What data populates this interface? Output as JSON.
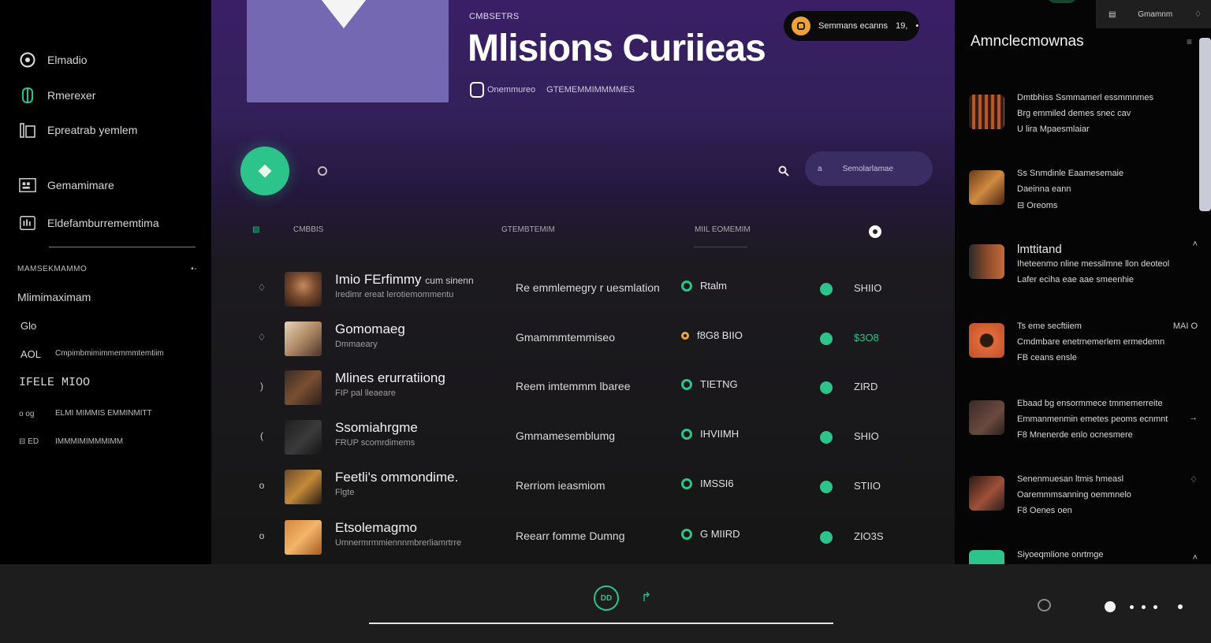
{
  "sidebar": {
    "nav": [
      {
        "label": "Elmadio",
        "icon": "home-icon"
      },
      {
        "label": "Rmerexer",
        "icon": "explore-icon"
      },
      {
        "label": "Epreatrab yemlem",
        "icon": "library-icon"
      },
      {
        "label": "Gemamimare",
        "icon": "calendar-icon"
      },
      {
        "label": "Eldefamburrememtima",
        "icon": "playlist-icon"
      }
    ],
    "section_head": "MAMSEKMAMMO",
    "section_toggle": "•-",
    "items": [
      {
        "label": "Mlimimaximam"
      },
      {
        "label": "Glo"
      },
      {
        "prefix": "AOL",
        "label": "Cmpimbmimimmemmmtemtiim"
      },
      {
        "label": "IFELE MIOO"
      },
      {
        "prefix": "o og",
        "label": "ELMI MIMMIS EMMINMITT"
      },
      {
        "prefix": "⊟ ED",
        "label": "IMMMIMIMMMIMM"
      }
    ]
  },
  "header": {
    "eyebrow": "CMBSETRS",
    "title": "Mlisions Curiieas",
    "meta_a": "Onemmureo",
    "meta_b": "GTEMEMMIMMMMES",
    "now_playing": "Semmans ecanns",
    "now_count": "19,",
    "now_icon": "•"
  },
  "controls": {
    "search_placeholder": "Semolarlamae",
    "search_prefix": "a"
  },
  "table": {
    "headers": {
      "title": "CMBBIS",
      "album": "GTEMBTEMIM",
      "status": "MIIL EOMEMIM"
    },
    "rows": [
      {
        "num": "♢",
        "title": "Imio FErfimmy",
        "title_extra": "cum sinenn",
        "subtitle": "Iredimr ereat lerotiemommentu",
        "album": "Re emmlemegry r uesmlation",
        "status": "Rtalm",
        "ring": "green",
        "duration": "SHIIO",
        "dur_color": "normal"
      },
      {
        "num": "♢",
        "title": "Gomomaeg",
        "title_extra": "",
        "subtitle": "Dmmaeary",
        "album": "Gmammmtemmiseo",
        "status": "f8G8 BIIO",
        "ring": "orange",
        "duration": "$3O8",
        "dur_color": "green"
      },
      {
        "num": ")",
        "title": "Mlines erurratiiong",
        "title_extra": "",
        "subtitle": "FIP pal lleaeare",
        "album": "Reem imtemmm lbaree",
        "status": "TIETNG",
        "ring": "green",
        "duration": "ZIRD",
        "dur_color": "normal"
      },
      {
        "num": "(",
        "title": "Ssomiahrgme",
        "title_extra": "",
        "subtitle": "FRUP scomrdimems",
        "album": "Gmmamesemblumg",
        "status": "IHVIIMH",
        "ring": "green",
        "duration": "SHIO",
        "dur_color": "normal"
      },
      {
        "num": "o",
        "title": "Feetli's ommondime.",
        "title_extra": "",
        "subtitle": "Flgte",
        "album": "Rerriom ieasmiom",
        "status": "IMSSI6",
        "ring": "green",
        "duration": "STIIO",
        "dur_color": "normal"
      },
      {
        "num": "o",
        "title": "Etsolemagmo",
        "title_extra": "",
        "subtitle": "Umnermrmmiennnmbrerliamrtrre",
        "album": "Reearr fomme Dumng",
        "status": "G MIIRD",
        "ring": "green",
        "duration": "ZIO3S",
        "dur_color": "normal"
      }
    ]
  },
  "right_panel": {
    "tab_label": "Gmamnm",
    "tab_icon": "♢",
    "title": "Amnclecmownas",
    "menu_icon": "≡",
    "items": [
      {
        "lines": [
          "Dmtbhiss Ssmmamerl essmmnmes",
          "Brg emmiled demes snec cav",
          "U lira Mpaesmlaiar"
        ],
        "ctrl": "",
        "big": false
      },
      {
        "lines": [
          "Ss Snmdinle Eaamesemaie",
          "Daeinna eann",
          "⊟ Oreoms"
        ],
        "ctrl": "",
        "big": false
      },
      {
        "lines": [
          "lmttitand",
          "Iheteenmo nline messilmne llon deoteol",
          "Lafer eciha eae aae smeenhie"
        ],
        "ctrl": "˄",
        "big": true
      },
      {
        "lines": [
          "Ts eme secftiiem",
          "Cmdmbare enetrnemerlem ermedemn",
          "FB ceans ensle"
        ],
        "ctrl": "MAI O",
        "big": false
      },
      {
        "lines": [
          "Ebaad bg ensormmece tmmemerreite",
          "Emmanmenmin emetes peoms ecnmnt",
          "F8 Mnenerde enlo ocnesmere"
        ],
        "ctrl": "→",
        "big": false
      },
      {
        "lines": [
          "Senenmuesan ltmis hmeasl",
          "Oaremmmsanning oemmnelo",
          "F8 Oenes oen"
        ],
        "ctrl": "♢",
        "big": false
      },
      {
        "lines": [
          "Siyoeqmlione onrtmge"
        ],
        "ctrl": "˄",
        "big": false
      }
    ]
  },
  "player": {
    "play_label": "DD",
    "next_icon": "↱",
    "volume_icon": "◎",
    "progress": 1.0
  }
}
